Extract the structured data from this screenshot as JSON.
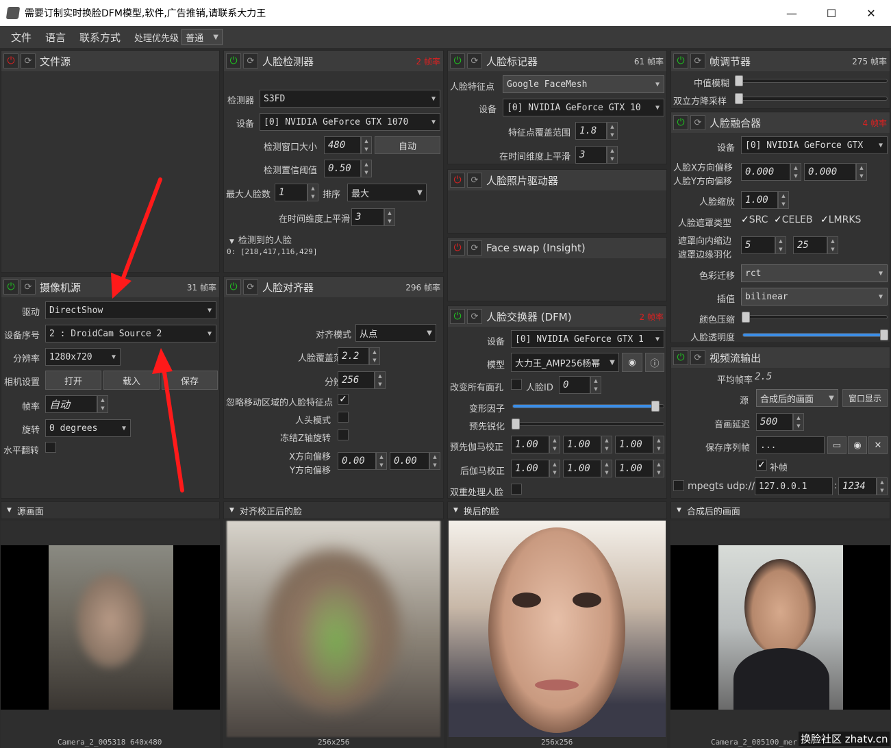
{
  "window": {
    "title": "需要订制实时换脸DFM模型,软件,广告推销,请联系大力王",
    "minimize": "—",
    "maximize": "☐",
    "close": "✕"
  },
  "menu": {
    "file": "文件",
    "language": "语言",
    "contact": "联系方式",
    "priority_label": "处理优先级",
    "priority_value": "普通"
  },
  "file_source": {
    "title": "文件源"
  },
  "camera": {
    "title": "摄像机源",
    "fps": "31 帧率",
    "driver_label": "驱动",
    "driver": "DirectShow",
    "device_label": "设备序号",
    "device": "2 : DroidCam Source 2",
    "res_label": "分辨率",
    "res": "1280x720",
    "cam_settings_label": "相机设置",
    "open": "打开",
    "load": "载入",
    "save": "保存",
    "fps_label": "帧率",
    "fps_value": "自动",
    "rotate_label": "旋转",
    "rotate": "0 degrees",
    "flip_label": "水平翻转"
  },
  "detector": {
    "title": "人脸检测器",
    "fps": "2 帧率",
    "detector_label": "检测器",
    "detector": "S3FD",
    "device_label": "设备",
    "device": "[0] NVIDIA GeForce GTX 1070",
    "win_label": "检测窗口大小",
    "win": "480",
    "auto": "自动",
    "thr_label": "检测置信阈值",
    "thr": "0.50",
    "max_label": "最大人脸数",
    "max": "1",
    "sort_label": "排序",
    "sort": "最大",
    "smooth_label": "在时间维度上平滑",
    "smooth": "3",
    "detected_label": "检测到的人脸",
    "detected": "0: [218,417,116,429]"
  },
  "aligner": {
    "title": "人脸对齐器",
    "fps": "296 帧率",
    "mode_label": "对齐模式",
    "mode": "从点",
    "cover_label": "人脸覆盖范围",
    "cover": "2.2",
    "res_label": "分辨率",
    "res": "256",
    "ignore_label": "忽略移动区域的人脸特征点",
    "head_label": "人头模式",
    "freeze_label": "冻结Z轴旋转",
    "xoff_label": "X方向偏移",
    "yoff_label": "Y方向偏移",
    "xoff": "0.00",
    "yoff": "0.00"
  },
  "marker": {
    "title": "人脸标记器",
    "fps": "61 帧率",
    "lm_label": "人脸特征点",
    "lm": "Google FaceMesh",
    "device_label": "设备",
    "device": "[0] NVIDIA GeForce GTX 10",
    "range_label": "特征点覆盖范围",
    "range": "1.8",
    "smooth_label": "在时间维度上平滑",
    "smooth": "3"
  },
  "photo_driver": {
    "title": "人脸照片驱动器"
  },
  "insight": {
    "title": "Face swap (Insight)"
  },
  "swapper": {
    "title": "人脸交换器 (DFM)",
    "fps": "2 帧率",
    "device_label": "设备",
    "device": "[0] NVIDIA GeForce GTX 1",
    "model_label": "模型",
    "model": "大力王_AMP256杨幂",
    "swap_all_label": "改变所有面孔",
    "face_id_label": "人脸ID",
    "face_id": "0",
    "morph_label": "变形因子",
    "morph": 0.96,
    "presharp_label": "预先锐化",
    "pregamma_label": "预先伽马校正",
    "postgamma_label": "后伽马校正",
    "gamma": "1.00",
    "dual_label": "双重处理人脸"
  },
  "adjuster": {
    "title": "帧调节器",
    "fps": "275 帧率",
    "median_label": "中值模糊",
    "bilinear_label": "双立方降采样"
  },
  "merger": {
    "title": "人脸融合器",
    "fps": "4 帧率",
    "device_label": "设备",
    "device": "[0] NVIDIA GeForce GTX",
    "xoff_label": "人脸X方向偏移",
    "yoff_label": "人脸Y方向偏移",
    "xoff": "0.000",
    "yoff": "0.000",
    "scale_label": "人脸缩放",
    "scale": "1.00",
    "mask_label": "人脸遮罩类型",
    "src": "SRC",
    "celeb": "CELEB",
    "lmrks": "LMRKS",
    "erode_label": "遮罩向内缩边",
    "blur_label": "遮罩边缘羽化",
    "erode": "5",
    "blur": "25",
    "color_label": "色彩迁移",
    "color": "rct",
    "interp_label": "插值",
    "interp": "bilinear",
    "compress_label": "颜色压缩",
    "opacity_label": "人脸透明度",
    "opacity": 1.0
  },
  "stream": {
    "title": "视频流输出",
    "avg_label": "平均帧率",
    "avg": "2.5",
    "source_label": "源",
    "source": "合成后的画面",
    "window_btn": "窗口显示",
    "delay_label": "音画延迟",
    "delay": "500",
    "save_label": "保存序列帧",
    "save_path": "...",
    "fill_label": "补帧",
    "mpeg_label": "mpegts udp://",
    "ip": "127.0.0.1",
    "colon": ":",
    "port": "1234"
  },
  "views": {
    "source": "源画面",
    "aligned": "对齐校正后的脸",
    "swapped": "换后的脸",
    "merged": "合成后的画面",
    "cap_source": "Camera_2_005318 640x480",
    "cap_aligned": "256x256",
    "cap_swapped": "256x256",
    "cap_merged": "Camera_2_005100_mer",
    "watermark": "换脸社区 zhatv.cn"
  }
}
